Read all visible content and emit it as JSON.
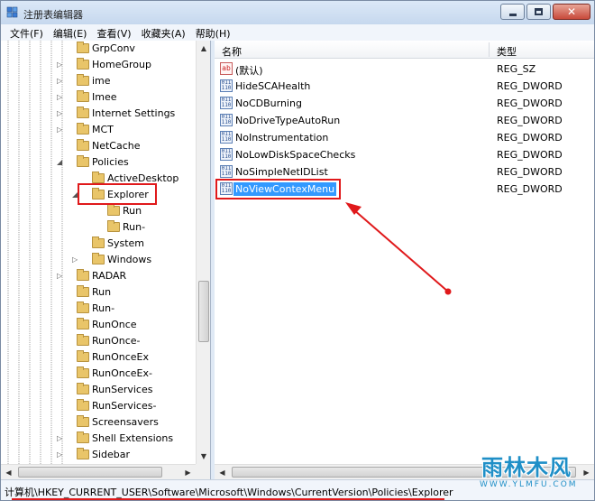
{
  "window": {
    "title": "注册表编辑器"
  },
  "menu": [
    "文件(F)",
    "编辑(E)",
    "查看(V)",
    "收藏夹(A)",
    "帮助(H)"
  ],
  "tree": [
    {
      "label": "GrpConv",
      "level": 0,
      "expander": ""
    },
    {
      "label": "HomeGroup",
      "level": 0,
      "expander": "collapsed"
    },
    {
      "label": "ime",
      "level": 0,
      "expander": "collapsed"
    },
    {
      "label": "Imee",
      "level": 0,
      "expander": "collapsed"
    },
    {
      "label": "Internet Settings",
      "level": 0,
      "expander": "collapsed"
    },
    {
      "label": "MCT",
      "level": 0,
      "expander": "collapsed"
    },
    {
      "label": "NetCache",
      "level": 0,
      "expander": ""
    },
    {
      "label": "Policies",
      "level": 0,
      "expander": "expanded"
    },
    {
      "label": "ActiveDesktop",
      "level": 1,
      "expander": ""
    },
    {
      "label": "Explorer",
      "level": 1,
      "expander": "expanded",
      "selected": true
    },
    {
      "label": "Run",
      "level": 2,
      "expander": ""
    },
    {
      "label": "Run-",
      "level": 2,
      "expander": ""
    },
    {
      "label": "System",
      "level": 1,
      "expander": ""
    },
    {
      "label": "Windows",
      "level": 1,
      "expander": "collapsed"
    },
    {
      "label": "RADAR",
      "level": 0,
      "expander": "collapsed"
    },
    {
      "label": "Run",
      "level": 0,
      "expander": ""
    },
    {
      "label": "Run-",
      "level": 0,
      "expander": ""
    },
    {
      "label": "RunOnce",
      "level": 0,
      "expander": ""
    },
    {
      "label": "RunOnce-",
      "level": 0,
      "expander": ""
    },
    {
      "label": "RunOnceEx",
      "level": 0,
      "expander": ""
    },
    {
      "label": "RunOnceEx-",
      "level": 0,
      "expander": ""
    },
    {
      "label": "RunServices",
      "level": 0,
      "expander": ""
    },
    {
      "label": "RunServices-",
      "level": 0,
      "expander": ""
    },
    {
      "label": "Screensavers",
      "level": 0,
      "expander": ""
    },
    {
      "label": "Shell Extensions",
      "level": 0,
      "expander": "collapsed"
    },
    {
      "label": "Sidebar",
      "level": 0,
      "expander": "collapsed"
    }
  ],
  "list": {
    "columns": {
      "name": "名称",
      "type": "类型"
    },
    "rows": [
      {
        "name": "(默认)",
        "type": "REG_SZ",
        "icon": "string-value-icon",
        "glyph": "ab"
      },
      {
        "name": "HideSCAHealth",
        "type": "REG_DWORD",
        "icon": "binary-value-icon",
        "glyph": "011\n110"
      },
      {
        "name": "NoCDBurning",
        "type": "REG_DWORD",
        "icon": "binary-value-icon",
        "glyph": "011\n110"
      },
      {
        "name": "NoDriveTypeAutoRun",
        "type": "REG_DWORD",
        "icon": "binary-value-icon",
        "glyph": "011\n110"
      },
      {
        "name": "NoInstrumentation",
        "type": "REG_DWORD",
        "icon": "binary-value-icon",
        "glyph": "011\n110"
      },
      {
        "name": "NoLowDiskSpaceChecks",
        "type": "REG_DWORD",
        "icon": "binary-value-icon",
        "glyph": "011\n110"
      },
      {
        "name": "NoSimpleNetIDList",
        "type": "REG_DWORD",
        "icon": "binary-value-icon",
        "glyph": "011\n110"
      },
      {
        "name": "NoViewContexMenu",
        "type": "REG_DWORD",
        "icon": "binary-value-icon",
        "glyph": "011\n110",
        "selected": true
      }
    ]
  },
  "statusbar": {
    "path": "计算机\\HKEY_CURRENT_USER\\Software\\Microsoft\\Windows\\CurrentVersion\\Policies\\Explorer"
  },
  "watermark": {
    "text": "雨林木风",
    "url": "WWW.YLMFU.COM"
  },
  "colors": {
    "annotation": "#e0191b",
    "selection": "#3399ff"
  }
}
